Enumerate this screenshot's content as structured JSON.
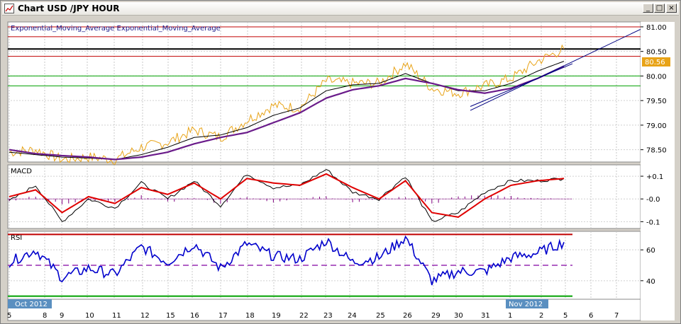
{
  "window": {
    "title": "Chart USD /JPY  HOUR",
    "buttons": {
      "minimize": "_",
      "maximize": "□",
      "close": "×"
    }
  },
  "colors": {
    "price": "#e8a317",
    "ema_fast": "#000000",
    "ema_slow": "#6a1b8a",
    "macd_line": "#000000",
    "macd_signal": "#e00000",
    "macd_hist": "#800080",
    "rsi": "#0000cc",
    "level_red": "#c00000",
    "level_green": "#00a000",
    "level_black": "#000000",
    "rsi_mid": "#8000a0",
    "trendline": "#000080",
    "price_tag_bg": "#e8a317",
    "date_highlight": "#5a8fc0"
  },
  "main_panel": {
    "label": "Exponential_Moving_Average Exponential_Moving_Average",
    "price_tag": "80.56",
    "y_ticks": [
      "81.00",
      "80.50",
      "80.00",
      "79.50",
      "79.00",
      "78.50"
    ]
  },
  "macd_panel": {
    "label": "MACD",
    "y_ticks": [
      "+0.1",
      "-0.0",
      "-0.1"
    ]
  },
  "rsi_panel": {
    "label": "RSI",
    "y_ticks": [
      "60",
      "40"
    ]
  },
  "x_axis": {
    "date_left": "Oct 2012",
    "date_right": "Nov 2012",
    "ticks": [
      "5",
      "8",
      "9",
      "10",
      "11",
      "12",
      "15",
      "16",
      "17",
      "18",
      "19",
      "22",
      "23",
      "24",
      "25",
      "26",
      "29",
      "30",
      "31",
      "1",
      "2",
      "5",
      "6",
      "7"
    ]
  },
  "chart_data": [
    {
      "type": "line",
      "title": "",
      "timeframe": "HOUR",
      "instrument": "USD /JPY",
      "x": [
        "5",
        "8",
        "9",
        "10",
        "11",
        "12",
        "15",
        "16",
        "17",
        "18",
        "19",
        "22",
        "23",
        "24",
        "25",
        "26",
        "29",
        "30",
        "31",
        "1",
        "2",
        "5"
      ],
      "series": [
        {
          "name": "",
          "values": [
            78.45,
            78.5,
            78.3,
            78.35,
            78.3,
            78.55,
            78.65,
            78.9,
            78.75,
            79.1,
            79.4,
            79.35,
            79.9,
            79.85,
            79.85,
            80.25,
            79.75,
            79.65,
            79.8,
            79.95,
            80.3,
            80.55
          ]
        },
        {
          "name": "Exponential_Moving_Average",
          "values": [
            78.45,
            78.4,
            78.35,
            78.33,
            78.3,
            78.4,
            78.55,
            78.75,
            78.8,
            78.95,
            79.2,
            79.35,
            79.7,
            79.82,
            79.85,
            80.05,
            79.85,
            79.7,
            79.7,
            79.85,
            80.1,
            80.3
          ]
        },
        {
          "name": "Exponential_Moving_Average",
          "values": [
            78.5,
            78.42,
            78.38,
            78.35,
            78.3,
            78.35,
            78.45,
            78.62,
            78.75,
            78.85,
            79.05,
            79.25,
            79.55,
            79.72,
            79.8,
            79.95,
            79.85,
            79.72,
            79.65,
            79.75,
            79.95,
            80.2
          ]
        }
      ],
      "horizontal_levels": [
        81.0,
        80.8,
        80.55,
        80.4,
        80.0,
        79.8
      ],
      "ylim": [
        78.25,
        81.1
      ],
      "grid": true
    },
    {
      "type": "line",
      "title": "MACD",
      "x": [
        "5",
        "8",
        "9",
        "10",
        "11",
        "12",
        "15",
        "16",
        "17",
        "18",
        "19",
        "22",
        "23",
        "24",
        "25",
        "26",
        "29",
        "30",
        "31",
        "1",
        "2",
        "5"
      ],
      "series": [
        {
          "name": "",
          "values": [
            -0.01,
            0.06,
            -0.1,
            0.0,
            -0.04,
            0.07,
            0.0,
            0.08,
            -0.03,
            0.11,
            0.05,
            0.06,
            0.13,
            0.03,
            0.0,
            0.1,
            -0.1,
            -0.06,
            0.03,
            0.08,
            0.08,
            0.09
          ]
        },
        {
          "name": "",
          "values": [
            0.01,
            0.04,
            -0.06,
            0.01,
            -0.02,
            0.05,
            0.02,
            0.07,
            0.0,
            0.09,
            0.07,
            0.06,
            0.11,
            0.05,
            0.0,
            0.08,
            -0.06,
            -0.08,
            0.0,
            0.06,
            0.08,
            0.09
          ]
        }
      ],
      "ylim": [
        -0.13,
        0.15
      ],
      "grid": true
    },
    {
      "type": "line",
      "title": "RSI",
      "x": [
        "5",
        "8",
        "9",
        "10",
        "11",
        "12",
        "15",
        "16",
        "17",
        "18",
        "19",
        "22",
        "23",
        "24",
        "25",
        "26",
        "29",
        "30",
        "31",
        "1",
        "2",
        "5"
      ],
      "series": [
        {
          "name": "",
          "values": [
            52,
            60,
            42,
            48,
            44,
            62,
            52,
            64,
            48,
            64,
            56,
            54,
            66,
            52,
            55,
            68,
            40,
            46,
            46,
            55,
            58,
            65
          ]
        }
      ],
      "levels": [
        70,
        50,
        30
      ],
      "ylim": [
        28,
        72
      ],
      "grid": true
    }
  ]
}
